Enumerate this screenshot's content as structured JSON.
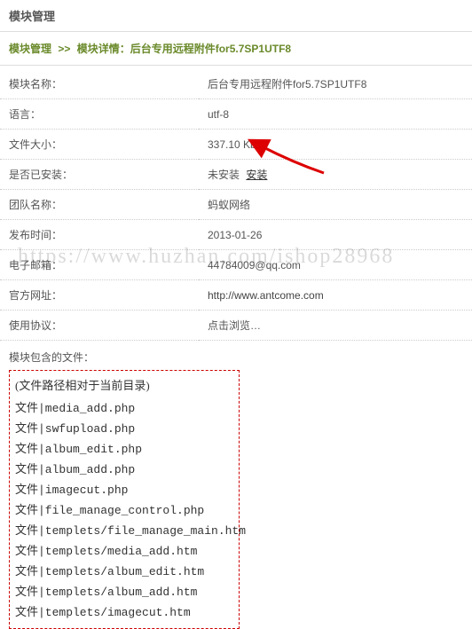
{
  "page": {
    "title": "模块管理"
  },
  "breadcrumb": {
    "link_label": "模块管理",
    "sep": ">>",
    "detail_label": "模块详情：后台专用远程附件for5.7SP1UTF8"
  },
  "rows": {
    "name": {
      "label": "模块名称：",
      "value": "后台专用远程附件for5.7SP1UTF8"
    },
    "lang": {
      "label": "语言：",
      "value": "utf-8"
    },
    "size": {
      "label": "文件大小：",
      "value": "337.10 Kb"
    },
    "installed": {
      "label": "是否已安装：",
      "status": "未安装",
      "action": "安装"
    },
    "team": {
      "label": "团队名称：",
      "value": "蚂蚁网络"
    },
    "date": {
      "label": "发布时间：",
      "value": "2013-01-26"
    },
    "email": {
      "label": "电子邮箱：",
      "value": "44784009@qq.com"
    },
    "site": {
      "label": "官方网址：",
      "value": "http://www.antcome.com"
    },
    "protocol": {
      "label": "使用协议：",
      "value": "点击浏览…"
    }
  },
  "files": {
    "section_title": "模块包含的文件：",
    "note": "(文件路径相对于当前目录)",
    "prefix": "文件|",
    "list": [
      "media_add.php",
      "swfupload.php",
      "album_edit.php",
      "album_add.php",
      "imagecut.php",
      "file_manage_control.php",
      "templets/file_manage_main.htm",
      "templets/media_add.htm",
      "templets/album_edit.htm",
      "templets/album_add.htm",
      "templets/imagecut.htm"
    ]
  },
  "watermark": "https://www.huzhan.com/ishop28968"
}
